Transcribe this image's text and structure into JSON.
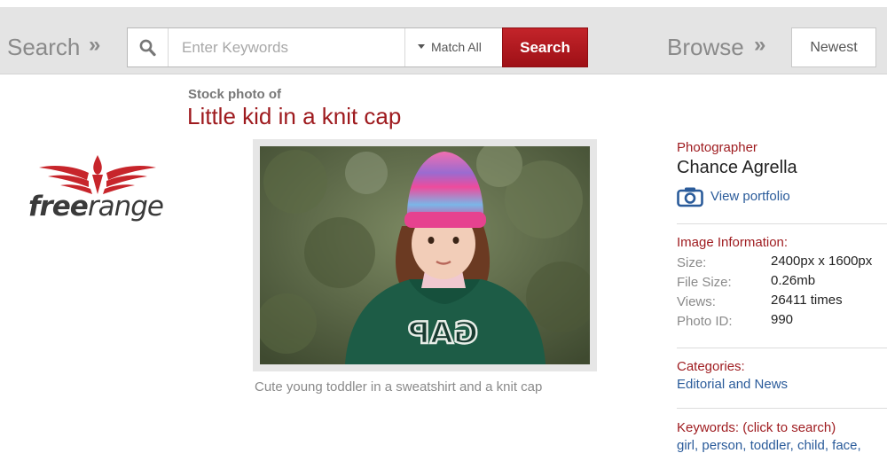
{
  "header": {
    "search_title": "Search",
    "search_arrows": "»",
    "search_placeholder": "Enter Keywords",
    "match_option": "Match All",
    "search_button": "Search",
    "browse_title": "Browse",
    "browse_arrows": "»",
    "newest_button": "Newest"
  },
  "logo": {
    "text_free": "free",
    "text_range": "range",
    "brand_color": "#c7252b"
  },
  "photo": {
    "prefix": "Stock photo of",
    "title": "Little kid in a knit cap",
    "caption": "Cute young toddler in a sweatshirt and a knit cap",
    "sweatshirt_text": "GAP"
  },
  "sidebar": {
    "photographer_label": "Photographer",
    "photographer_name": "Chance Agrella",
    "portfolio_link": "View portfolio",
    "image_info_label": "Image Information:",
    "info": [
      {
        "key": "Size:",
        "value": "2400px x 1600px"
      },
      {
        "key": "File Size:",
        "value": "0.26mb"
      },
      {
        "key": "Views:",
        "value": "26411 times"
      },
      {
        "key": "Photo ID:",
        "value": "990"
      }
    ],
    "categories_label": "Categories:",
    "category": "Editorial and News",
    "keywords_label": "Keywords: (click to search)",
    "keywords": [
      "girl",
      "person",
      "toddler",
      "child",
      "face"
    ]
  },
  "colors": {
    "accent_red": "#9e1a1e",
    "button_red": "#b01c21",
    "link_blue": "#2a5b9a",
    "topbar_gray": "#e4e4e4"
  }
}
